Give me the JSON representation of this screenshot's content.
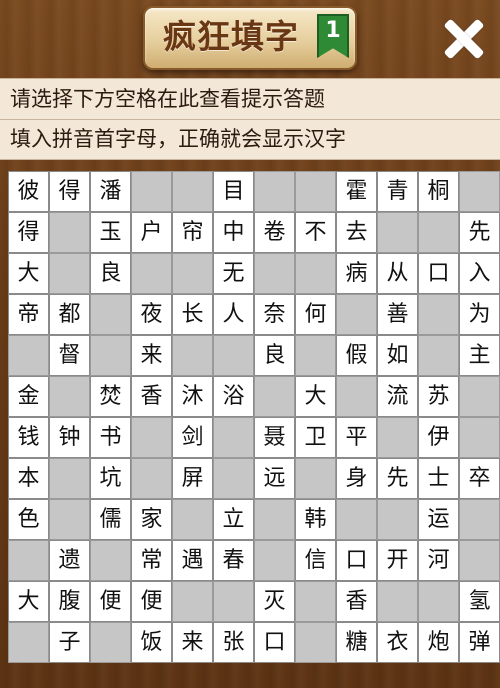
{
  "header": {
    "title": "疯狂填字",
    "level": "1"
  },
  "hint": {
    "line1": "请选择下方空格在此查看提示答题",
    "line2": "填入拼音首字母，正确就会显示汉字"
  },
  "grid": [
    [
      "彼",
      "得",
      "潘",
      "",
      "",
      "目",
      "",
      "",
      "霍",
      "青",
      "桐",
      ""
    ],
    [
      "得",
      "",
      "玉",
      "户",
      "帘",
      "中",
      "卷",
      "不",
      "去",
      "",
      "",
      "先"
    ],
    [
      "大",
      "",
      "良",
      "",
      "",
      "无",
      "",
      "",
      "病",
      "从",
      "口",
      "入"
    ],
    [
      "帝",
      "都",
      "",
      "夜",
      "长",
      "人",
      "奈",
      "何",
      "",
      "善",
      "",
      "为"
    ],
    [
      "",
      "督",
      "",
      "来",
      "",
      "",
      "良",
      "",
      "假",
      "如",
      "",
      "主"
    ],
    [
      "金",
      "",
      "焚",
      "香",
      "沐",
      "浴",
      "",
      "大",
      "",
      "流",
      "苏",
      ""
    ],
    [
      "钱",
      "钟",
      "书",
      "",
      "剑",
      "",
      "聂",
      "卫",
      "平",
      "",
      "伊",
      ""
    ],
    [
      "本",
      "",
      "坑",
      "",
      "屏",
      "",
      "远",
      "",
      "身",
      "先",
      "士",
      "卒"
    ],
    [
      "色",
      "",
      "儒",
      "家",
      "",
      "立",
      "",
      "韩",
      "",
      "",
      "运",
      ""
    ],
    [
      "",
      "遗",
      "",
      "常",
      "遇",
      "春",
      "",
      "信",
      "口",
      "开",
      "河",
      ""
    ],
    [
      "大",
      "腹",
      "便",
      "便",
      "",
      "",
      "灭",
      "",
      "香",
      "",
      "",
      "氢"
    ],
    [
      "",
      "子",
      "",
      "饭",
      "来",
      "张",
      "口",
      "",
      "糖",
      "衣",
      "炮",
      "弹"
    ]
  ]
}
